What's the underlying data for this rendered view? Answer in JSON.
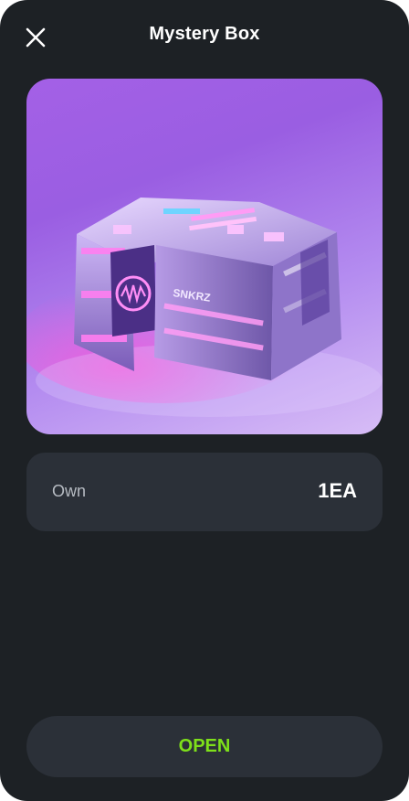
{
  "header": {
    "title": "Mystery Box",
    "close_icon": "close-icon"
  },
  "item": {
    "image_alt": "mystery-box-image",
    "box_emblem_text": "SNKRZ"
  },
  "own": {
    "label": "Own",
    "value": "1EA"
  },
  "actions": {
    "open_label": "OPEN"
  },
  "colors": {
    "background": "#1d2125",
    "card": "#2b3038",
    "accent": "#7ee01a",
    "text_primary": "#ffffff",
    "text_secondary": "#b6bbc2"
  }
}
